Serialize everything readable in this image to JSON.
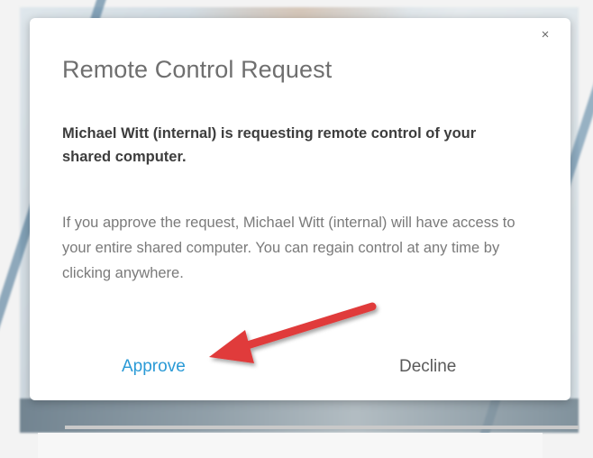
{
  "dialog": {
    "title": "Remote Control Request",
    "message": "Michael Witt (internal) is requesting remote control of your shared computer.",
    "detail": "If you approve the request, Michael Witt (internal) will have access to your entire shared computer. You can regain control at any time by clicking anywhere.",
    "close_label": "×",
    "approve_label": "Approve",
    "decline_label": "Decline"
  },
  "annotation": {
    "arrow_icon": "red-arrow-icon",
    "arrow_color": "#e03a3a"
  },
  "colors": {
    "accent": "#2a9ad6",
    "title": "#6f6f6f",
    "message": "#3d3d3d",
    "detail": "#7a7a7a"
  }
}
